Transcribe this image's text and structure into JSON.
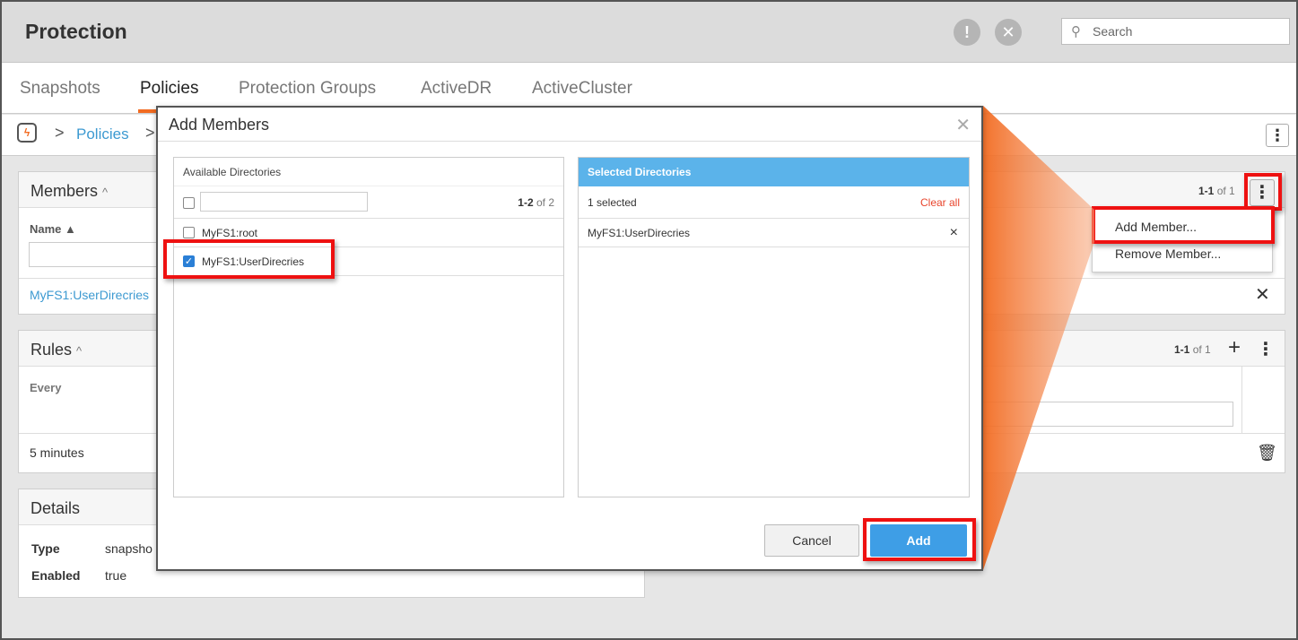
{
  "app_title": "Protection",
  "search": {
    "placeholder": "Search"
  },
  "tabs": [
    "Snapshots",
    "Policies",
    "Protection Groups",
    "ActiveDR",
    "ActiveCluster"
  ],
  "breadcrumb": {
    "separator": ">",
    "policies_link": "Policies"
  },
  "members": {
    "title": "Members",
    "count_bold": "1-1",
    "count_rest": "of 1",
    "name_header": "Name",
    "row_value": "MyFS1:UserDirecries"
  },
  "rules": {
    "title": "Rules",
    "count_bold": "1-1",
    "count_rest": "of 1",
    "column": "Every",
    "value": "5 minutes"
  },
  "details": {
    "title": "Details",
    "type_label": "Type",
    "type_value": "snapsho",
    "enabled_label": "Enabled",
    "enabled_value": "true"
  },
  "dropdown": {
    "items": [
      "Add Member...",
      "Remove Member..."
    ]
  },
  "dialog": {
    "title": "Add Members",
    "available": {
      "header": "Available Directories",
      "count_bold": "1-2",
      "count_rest": "of 2",
      "items": [
        {
          "label": "MyFS1:root",
          "checked": false
        },
        {
          "label": "MyFS1:UserDirecries",
          "checked": true
        }
      ]
    },
    "selected": {
      "header": "Selected Directories",
      "count_text": "1 selected",
      "clear_label": "Clear all",
      "items": [
        "MyFS1:UserDirecries"
      ],
      "remove_glyph": "×"
    },
    "cancel_label": "Cancel",
    "add_label": "Add"
  },
  "colors": {
    "accent": "#f26b21",
    "link": "#3d9ad1",
    "highlight": "#ee1111",
    "selected_header": "#5bb3ea",
    "primary_button": "#3e9ee6"
  }
}
